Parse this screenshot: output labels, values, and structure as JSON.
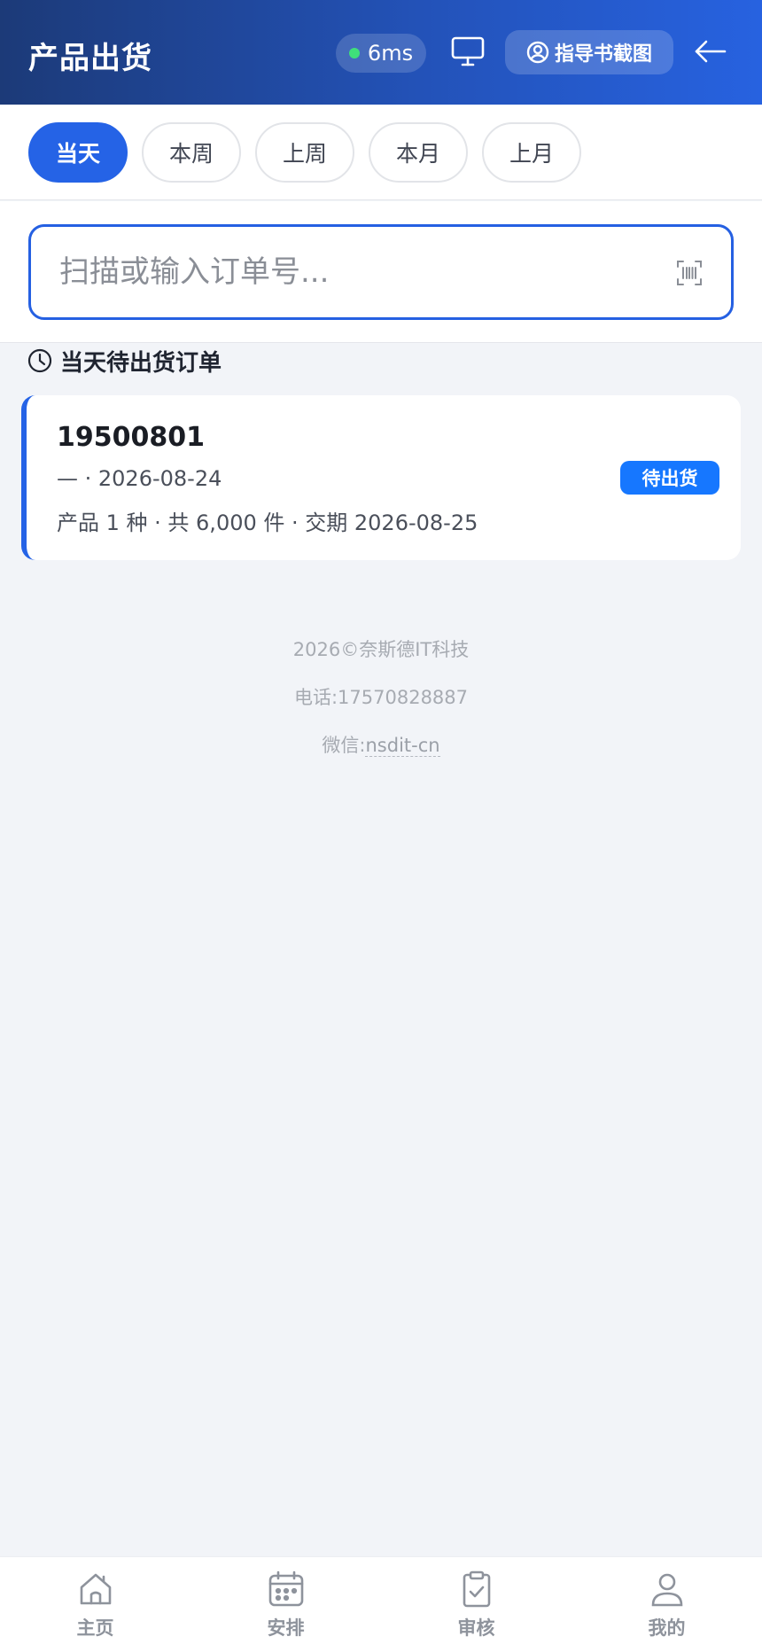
{
  "header": {
    "title": "产品出货",
    "ping": "6ms",
    "guide_label": "指导书截图",
    "colors": {
      "gradient_start": "#1c3a78",
      "gradient_end": "#2762e0",
      "ping_dot": "#3fe07a"
    },
    "icons": [
      "monitor-icon",
      "user-circle-icon",
      "arrow-left-icon"
    ]
  },
  "filters": {
    "items": [
      "当天",
      "本周",
      "上周",
      "本月",
      "上月"
    ],
    "active": "当天",
    "active_color": "#2563e6"
  },
  "search": {
    "placeholder": "扫描或输入订单号...",
    "value": "",
    "icon": "barcode-scan-icon"
  },
  "section": {
    "title": "当天待出货订单",
    "icon": "clock-icon"
  },
  "orders": [
    {
      "order_no": "19500801",
      "meta": "— · 2026-08-24",
      "summary": "产品 1 种 · 共 6,000 件 · 交期 2026-08-25",
      "status": "待出货",
      "status_color": "#1677ff"
    }
  ],
  "footer": {
    "copyright": "2026©奈斯德IT科技",
    "phone_label": "电话:",
    "phone": "17570828887",
    "wechat_label": "微信:",
    "wechat": "nsdit-cn"
  },
  "tabbar": {
    "items": [
      {
        "label": "主页",
        "icon": "home-icon"
      },
      {
        "label": "安排",
        "icon": "calendar-icon"
      },
      {
        "label": "审核",
        "icon": "clipboard-check-icon"
      },
      {
        "label": "我的",
        "icon": "user-icon"
      }
    ]
  }
}
